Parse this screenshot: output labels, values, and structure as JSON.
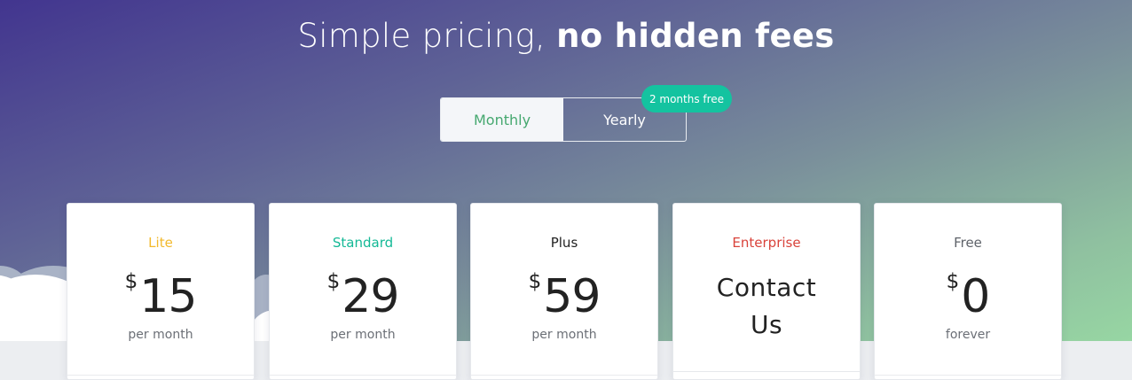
{
  "hero": {
    "title_light": "Simple pricing, ",
    "title_bold": "no hidden fees"
  },
  "billing_toggle": {
    "monthly_label": "Monthly",
    "yearly_label": "Yearly",
    "selected": "Monthly",
    "badge_label": "2 months free"
  },
  "colors": {
    "lite": "#f2b92c",
    "standard": "#14b996",
    "plus": "#222222",
    "enterprise": "#d9433b",
    "free": "#5f636a",
    "toggle_active_text": "#46a870",
    "badge": "#14c3a0"
  },
  "plans": [
    {
      "name": "Lite",
      "currency": "$",
      "amount": "15",
      "period": "per month"
    },
    {
      "name": "Standard",
      "currency": "$",
      "amount": "29",
      "period": "per month"
    },
    {
      "name": "Plus",
      "currency": "$",
      "amount": "59",
      "period": "per month"
    },
    {
      "name": "Enterprise",
      "contact_line1": "Contact",
      "contact_line2": "Us"
    },
    {
      "name": "Free",
      "currency": "$",
      "amount": "0",
      "period": "forever"
    }
  ]
}
